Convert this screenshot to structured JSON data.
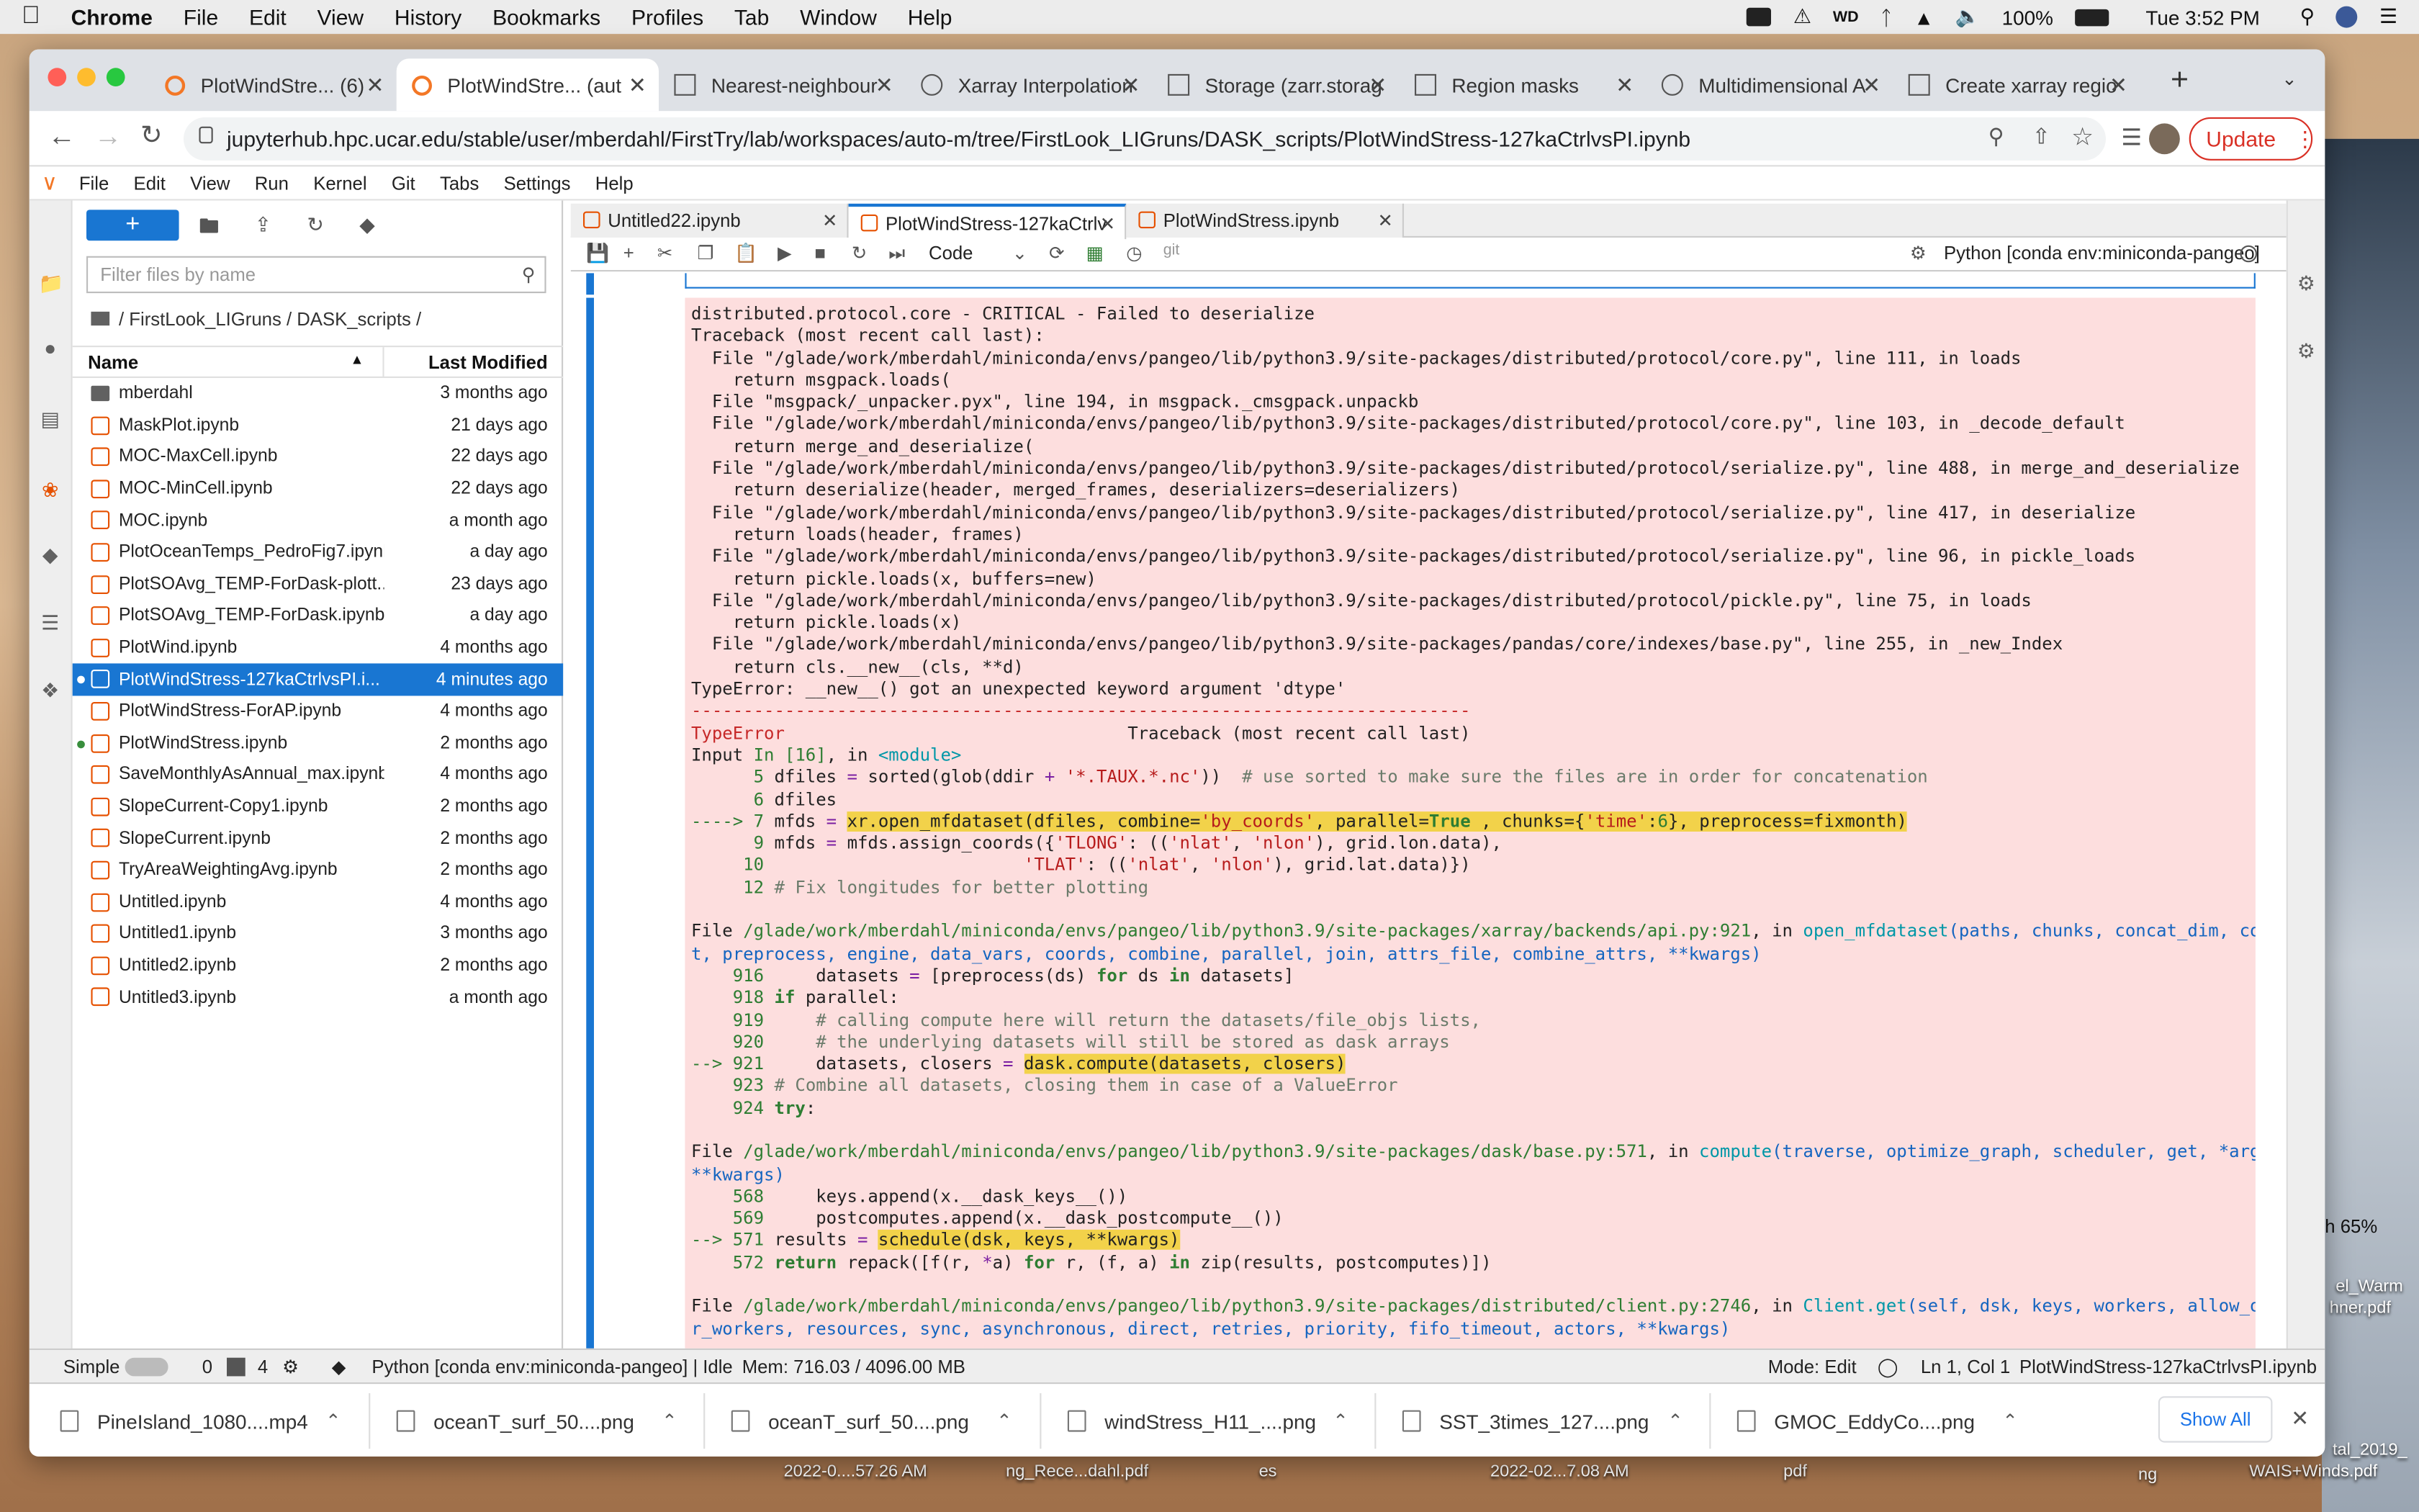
{
  "menubar": {
    "app": "Chrome",
    "items": [
      "File",
      "Edit",
      "View",
      "History",
      "Bookmarks",
      "Profiles",
      "Tab",
      "Window",
      "Help"
    ],
    "battery": "100%",
    "clock": "Tue 3:52 PM"
  },
  "tabs": [
    {
      "title": "PlotWindStre... (6)",
      "icon": "jupyter-icon"
    },
    {
      "title": "PlotWindStre... (aut",
      "icon": "jupyter-icon"
    },
    {
      "title": "Nearest-neighbour",
      "icon": "page-icon"
    },
    {
      "title": "Xarray Interpolation",
      "icon": "globe-icon"
    },
    {
      "title": "Storage (zarr.storag",
      "icon": "page-icon"
    },
    {
      "title": "Region masks",
      "icon": "page-icon"
    },
    {
      "title": "Multidimensional A",
      "icon": "globe-icon"
    },
    {
      "title": "Create xarray regio",
      "icon": "page-icon"
    }
  ],
  "address": {
    "url": "jupyterhub.hpc.ucar.edu/stable/user/mberdahl/FirstTry/lab/workspaces/auto-m/tree/FirstLook_LIGruns/DASK_scripts/PlotWindStress-127kaCtrlvsPI.ipynb",
    "update": "Update"
  },
  "jmenu": [
    "File",
    "Edit",
    "View",
    "Run",
    "Kernel",
    "Git",
    "Tabs",
    "Settings",
    "Help"
  ],
  "filebrowser": {
    "filter_placeholder": "Filter files by name",
    "breadcrumb": "/ FirstLook_LIGruns / DASK_scripts /",
    "col_name": "Name",
    "col_modified": "Last Modified",
    "files": [
      {
        "name": "mberdahl",
        "time": "3 months ago"
      },
      {
        "name": "MaskPlot.ipynb",
        "time": "21 days ago"
      },
      {
        "name": "MOC-MaxCell.ipynb",
        "time": "22 days ago"
      },
      {
        "name": "MOC-MinCell.ipynb",
        "time": "22 days ago"
      },
      {
        "name": "MOC.ipynb",
        "time": "a month ago"
      },
      {
        "name": "PlotOceanTemps_PedroFig7.ipynb",
        "time": "a day ago"
      },
      {
        "name": "PlotSOAvg_TEMP-ForDask-plott...",
        "time": "23 days ago"
      },
      {
        "name": "PlotSOAvg_TEMP-ForDask.ipynb",
        "time": "a day ago"
      },
      {
        "name": "PlotWind.ipynb",
        "time": "4 months ago"
      },
      {
        "name": "PlotWindStress-127kaCtrlvsPI.i...",
        "time": "4 minutes ago"
      },
      {
        "name": "PlotWindStress-ForAP.ipynb",
        "time": "4 months ago"
      },
      {
        "name": "PlotWindStress.ipynb",
        "time": "2 months ago"
      },
      {
        "name": "SaveMonthlyAsAnnual_max.ipynb",
        "time": "4 months ago"
      },
      {
        "name": "SlopeCurrent-Copy1.ipynb",
        "time": "2 months ago"
      },
      {
        "name": "SlopeCurrent.ipynb",
        "time": "2 months ago"
      },
      {
        "name": "TryAreaWeightingAvg.ipynb",
        "time": "2 months ago"
      },
      {
        "name": "Untitled.ipynb",
        "time": "4 months ago"
      },
      {
        "name": "Untitled1.ipynb",
        "time": "3 months ago"
      },
      {
        "name": "Untitled2.ipynb",
        "time": "2 months ago"
      },
      {
        "name": "Untitled3.ipynb",
        "time": "a month ago"
      }
    ]
  },
  "notebook_tabs": [
    "Untitled22.ipynb",
    "PlotWindStress-127kaCtrlv",
    "PlotWindStress.ipynb"
  ],
  "toolbar": {
    "cell_type": "Code",
    "git": "git",
    "kernel": "Python [conda env:miniconda-pangeo]"
  },
  "status": {
    "mode_simple": "Simple",
    "n0": "0",
    "n4": "4",
    "kernel": "Python [conda env:miniconda-pangeo] | Idle",
    "mem": "Mem: 716.03 / 4096.00 MB",
    "mode": "Mode: Edit",
    "pos": "Ln 1, Col 1",
    "file": "PlotWindStress-127kaCtrlvsPI.ipynb"
  },
  "downloads": [
    "PineIsland_1080....mp4",
    "oceanT_surf_50....png",
    "oceanT_surf_50....png",
    "windStress_H11_....png",
    "SST_3times_127....png",
    "GMOC_EddyCo....png"
  ],
  "show_all": "Show All",
  "desktop": {
    "labels": [
      "2022-0....57.26 AM",
      "ng_Rece...dahl.pdf",
      "es",
      "2022-02...7.08 AM",
      "pdf",
      "ng",
      "WAIS+Winds.pdf",
      "h 65%",
      "el_Warm",
      "hner.pdf",
      "tal_2019_"
    ]
  }
}
